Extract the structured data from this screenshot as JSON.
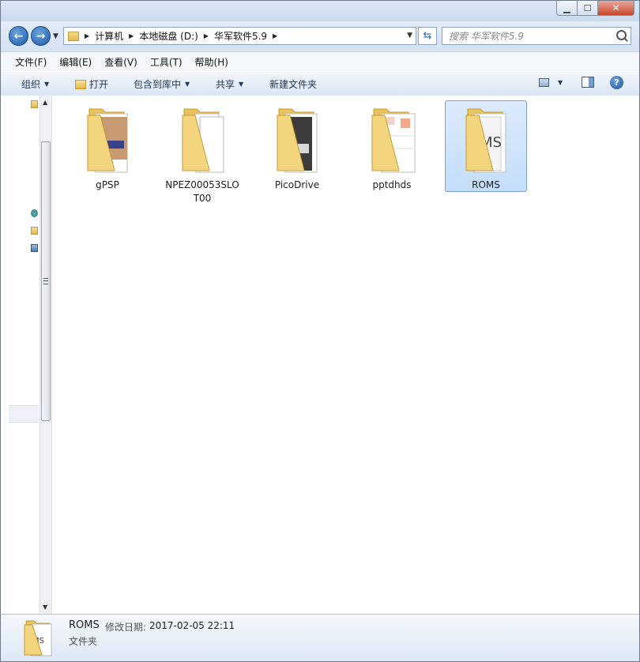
{
  "addressbar": {
    "crumbs": [
      "计算机",
      "本地磁盘 (D:)",
      "华军软件5.9"
    ]
  },
  "search": {
    "placeholder": "搜索 华军软件5.9"
  },
  "menu": {
    "items": [
      "文件(F)",
      "编辑(E)",
      "查看(V)",
      "工具(T)",
      "帮助(H)"
    ]
  },
  "toolbar": {
    "organize": "组织",
    "open": "打开",
    "include_in_library": "包含到库中",
    "share": "共享",
    "new_folder": "新建文件夹"
  },
  "folders": [
    {
      "name": "gPSP"
    },
    {
      "name": "NPEZ00053SLOT00"
    },
    {
      "name": "PicoDrive"
    },
    {
      "name": "pptdhds"
    },
    {
      "name": "ROMS",
      "selected": true
    }
  ],
  "details": {
    "name": "ROMS",
    "modified_label": "修改日期:",
    "modified_value": "2017-02-05 22:11",
    "type": "文件夹"
  },
  "colors": {
    "selection": "#cce4fb",
    "selection_border": "#7da2ce",
    "folder": "#efcb6a"
  }
}
